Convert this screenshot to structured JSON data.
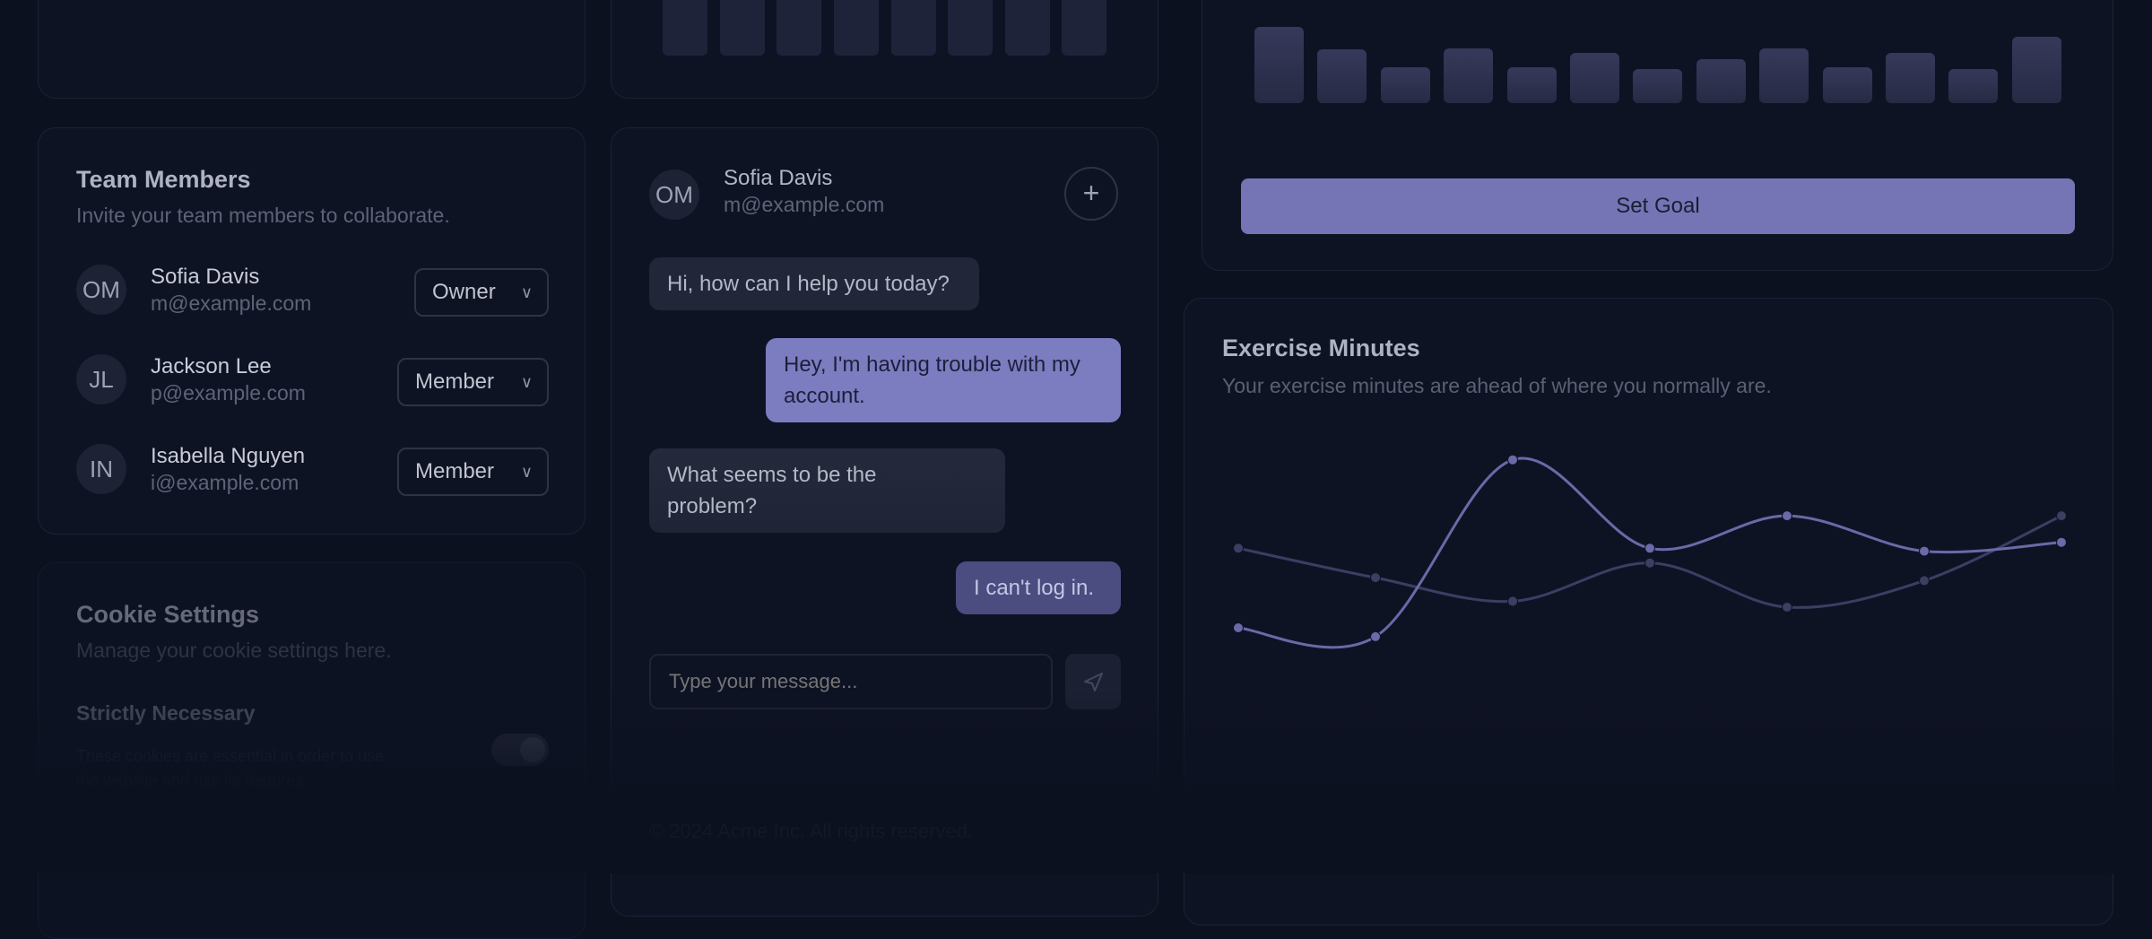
{
  "team": {
    "title": "Team Members",
    "description": "Invite your team members to collaborate.",
    "members": [
      {
        "initials": "OM",
        "name": "Sofia Davis",
        "email": "m@example.com",
        "role": "Owner"
      },
      {
        "initials": "JL",
        "name": "Jackson Lee",
        "email": "p@example.com",
        "role": "Member"
      },
      {
        "initials": "IN",
        "name": "Isabella Nguyen",
        "email": "i@example.com",
        "role": "Member"
      }
    ]
  },
  "cookies": {
    "title": "Cookie Settings",
    "description": "Manage your cookie settings here.",
    "strict_label": "Strictly Necessary",
    "strict_desc_1": "These cookies are essential in order to use",
    "strict_desc_2": "the website and use its features.",
    "strict_enabled": true
  },
  "chat": {
    "contact": {
      "initials": "OM",
      "name": "Sofia Davis",
      "email": "m@example.com"
    },
    "add_icon": "plus-icon",
    "messages": [
      {
        "from": "agent",
        "text": "Hi, how can I help you today?"
      },
      {
        "from": "user",
        "text_1": "Hey, I'm having trouble with my",
        "text_2": "account."
      },
      {
        "from": "agent",
        "text_1": "What seems to be the",
        "text_2": "problem?"
      },
      {
        "from": "user",
        "text": "I can't log in."
      }
    ],
    "input_placeholder": "Type your message...",
    "send_icon": "send-icon"
  },
  "goal": {
    "button_label": "Set Goal",
    "bars": [
      0.95,
      0.67,
      0.44,
      0.68,
      0.45,
      0.62,
      0.42,
      0.54,
      0.68,
      0.45,
      0.62,
      0.42,
      0.82
    ]
  },
  "exercise": {
    "title": "Exercise Minutes",
    "description": "Your exercise minutes are ahead of where you normally are.",
    "chart_data": {
      "type": "line",
      "x": [
        1,
        2,
        3,
        4,
        5,
        6,
        7
      ],
      "series": [
        {
          "values": [
            35,
            20,
            320,
            170,
            225,
            165,
            180
          ]
        },
        {
          "values": [
            170,
            120,
            80,
            145,
            70,
            115,
            225
          ]
        }
      ],
      "ylim": [
        0,
        350
      ],
      "colors": [
        "#6a6aa8",
        "#3c3e62"
      ]
    }
  },
  "footer_faint": "© 2024 Acme Inc. All rights reserved."
}
